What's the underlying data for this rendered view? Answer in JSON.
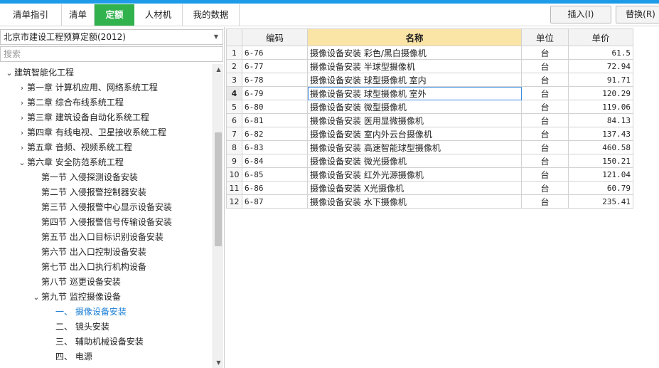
{
  "tabs": [
    {
      "label": "清单指引",
      "active": false
    },
    {
      "label": "清单",
      "active": false
    },
    {
      "label": "定额",
      "active": true
    },
    {
      "label": "人材机",
      "active": false
    },
    {
      "label": "我的数据",
      "active": false
    }
  ],
  "toolbar": {
    "insert_label": "插入(I)",
    "replace_label": "替换(R)"
  },
  "quota_library": {
    "selected": "北京市建设工程预算定额(2012)"
  },
  "search": {
    "placeholder": "搜索"
  },
  "tree": [
    {
      "label": "建筑智能化工程",
      "expander": "collapse"
    },
    {
      "label": "第一章 计算机应用、网络系统工程",
      "expander": "expand"
    },
    {
      "label": "第二章 综合布线系统工程",
      "expander": "expand"
    },
    {
      "label": "第三章 建筑设备自动化系统工程",
      "expander": "expand"
    },
    {
      "label": "第四章 有线电视、卫星接收系统工程",
      "expander": "expand"
    },
    {
      "label": "第五章 音频、视频系统工程",
      "expander": "expand"
    },
    {
      "label": "第六章 安全防范系统工程",
      "expander": "collapse"
    },
    {
      "label": "第一节 入侵探测设备安装",
      "expander": ""
    },
    {
      "label": "第二节 入侵报警控制器安装",
      "expander": ""
    },
    {
      "label": "第三节 入侵报警中心显示设备安装",
      "expander": ""
    },
    {
      "label": "第四节 入侵报警信号传输设备安装",
      "expander": ""
    },
    {
      "label": "第五节 出入口目标识别设备安装",
      "expander": ""
    },
    {
      "label": "第六节 出入口控制设备安装",
      "expander": ""
    },
    {
      "label": "第七节 出入口执行机构设备",
      "expander": ""
    },
    {
      "label": "第八节 巡更设备安装",
      "expander": ""
    },
    {
      "label": "第九节 监控摄像设备",
      "expander": "collapse"
    },
    {
      "label": "一、 摄像设备安装",
      "expander": "",
      "selected": true
    },
    {
      "label": "二、 镜头安装",
      "expander": ""
    },
    {
      "label": "三、 辅助机械设备安装",
      "expander": ""
    },
    {
      "label": "四、 电源",
      "expander": ""
    }
  ],
  "grid": {
    "columns": [
      "编码",
      "名称",
      "单位",
      "单价"
    ],
    "current_row": 4,
    "rows": [
      {
        "no": "1",
        "code": "6-76",
        "name": "摄像设备安装 彩色/黑白摄像机",
        "unit": "台",
        "price": "61.5"
      },
      {
        "no": "2",
        "code": "6-77",
        "name": "摄像设备安装 半球型摄像机",
        "unit": "台",
        "price": "72.94"
      },
      {
        "no": "3",
        "code": "6-78",
        "name": "摄像设备安装 球型摄像机 室内",
        "unit": "台",
        "price": "91.71"
      },
      {
        "no": "4",
        "code": "6-79",
        "name": "摄像设备安装 球型摄像机 室外",
        "unit": "台",
        "price": "120.29"
      },
      {
        "no": "5",
        "code": "6-80",
        "name": "摄像设备安装 微型摄像机",
        "unit": "台",
        "price": "119.06"
      },
      {
        "no": "6",
        "code": "6-81",
        "name": "摄像设备安装 医用显微摄像机",
        "unit": "台",
        "price": "84.13"
      },
      {
        "no": "7",
        "code": "6-82",
        "name": "摄像设备安装 室内外云台摄像机",
        "unit": "台",
        "price": "137.43"
      },
      {
        "no": "8",
        "code": "6-83",
        "name": "摄像设备安装 高速智能球型摄像机",
        "unit": "台",
        "price": "460.58"
      },
      {
        "no": "9",
        "code": "6-84",
        "name": "摄像设备安装 微光摄像机",
        "unit": "台",
        "price": "150.21"
      },
      {
        "no": "10",
        "code": "6-85",
        "name": "摄像设备安装 红外光源摄像机",
        "unit": "台",
        "price": "121.04"
      },
      {
        "no": "11",
        "code": "6-86",
        "name": "摄像设备安装 X光摄像机",
        "unit": "台",
        "price": "60.79"
      },
      {
        "no": "12",
        "code": "6-87",
        "name": "摄像设备安装 水下摄像机",
        "unit": "台",
        "price": "235.41"
      }
    ]
  },
  "colors": {
    "accent": "#1e9be8",
    "active_tab": "#31b24d",
    "name_header": "#fae4a6",
    "selected_text": "#1a7fd4"
  }
}
